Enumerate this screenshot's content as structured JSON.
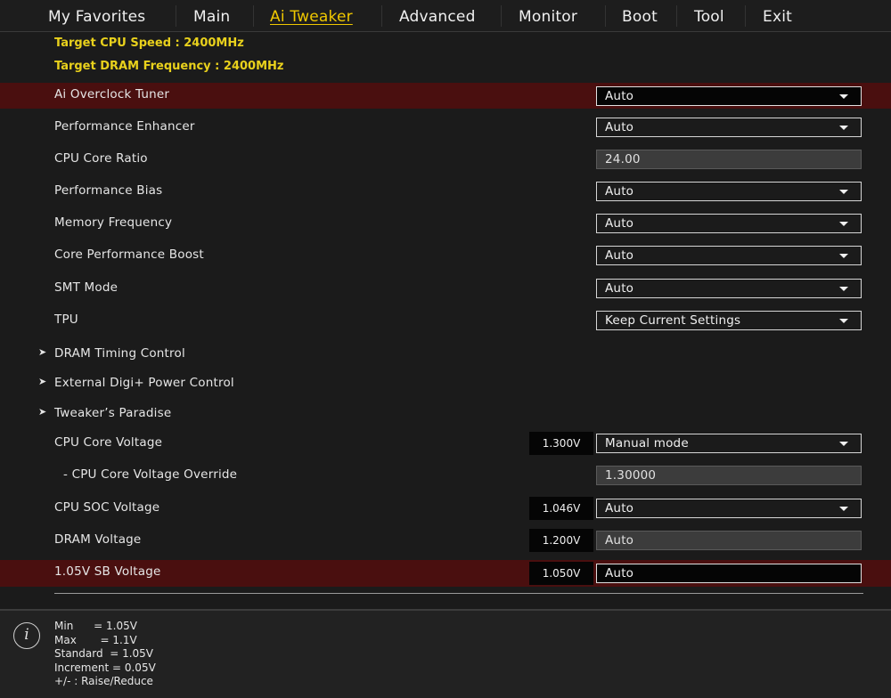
{
  "tabs": [
    "My Favorites",
    "Main",
    "Ai Tweaker",
    "Advanced",
    "Monitor",
    "Boot",
    "Tool",
    "Exit"
  ],
  "active_tab": "Ai Tweaker",
  "targets": {
    "cpu_speed": "Target CPU Speed : 2400MHz",
    "dram_freq": "Target DRAM Frequency : 2400MHz"
  },
  "settings": [
    {
      "label": "Ai Overclock Tuner",
      "value": "Auto",
      "type": "dropdown",
      "selected": true
    },
    {
      "label": "Performance Enhancer",
      "value": "Auto",
      "type": "dropdown"
    },
    {
      "label": "CPU Core Ratio",
      "value": "24.00",
      "type": "input"
    },
    {
      "label": "Performance Bias",
      "value": "Auto",
      "type": "dropdown"
    },
    {
      "label": "Memory Frequency",
      "value": "Auto",
      "type": "dropdown"
    },
    {
      "label": "Core Performance Boost",
      "value": "Auto",
      "type": "dropdown"
    },
    {
      "label": "SMT Mode",
      "value": "Auto",
      "type": "dropdown"
    },
    {
      "label": "TPU",
      "value": "Keep Current Settings",
      "type": "dropdown"
    },
    {
      "label": "DRAM Timing Control",
      "type": "submenu"
    },
    {
      "label": "External Digi+ Power Control",
      "type": "submenu"
    },
    {
      "label": "Tweaker’s Paradise",
      "type": "submenu"
    },
    {
      "label": "CPU Core Voltage",
      "voltage": "1.300V",
      "value": "Manual mode",
      "type": "dropdown"
    },
    {
      "label": "- CPU Core Voltage Override",
      "value": "1.30000",
      "type": "input",
      "indent": true
    },
    {
      "label": "CPU SOC Voltage",
      "voltage": "1.046V",
      "value": "Auto",
      "type": "dropdown"
    },
    {
      "label": "DRAM Voltage",
      "voltage": "1.200V",
      "value": "Auto",
      "type": "input"
    },
    {
      "label": "1.05V SB Voltage",
      "voltage": "1.050V",
      "value": "Auto",
      "type": "edit",
      "selected": true
    }
  ],
  "help": {
    "lines": [
      "Min      = 1.05V",
      "Max       = 1.1V",
      "Standard  = 1.05V",
      "Increment = 0.05V",
      "+/- : Raise/Reduce"
    ]
  },
  "colors": {
    "accent": "#f0c800",
    "target_text": "#e9d11c",
    "selected_row": "#4a0f0f",
    "background": "#1b1b1b"
  },
  "icons": {
    "help": "info-icon",
    "submenu": "arrow-right-icon",
    "dropdown": "caret-down-icon"
  }
}
